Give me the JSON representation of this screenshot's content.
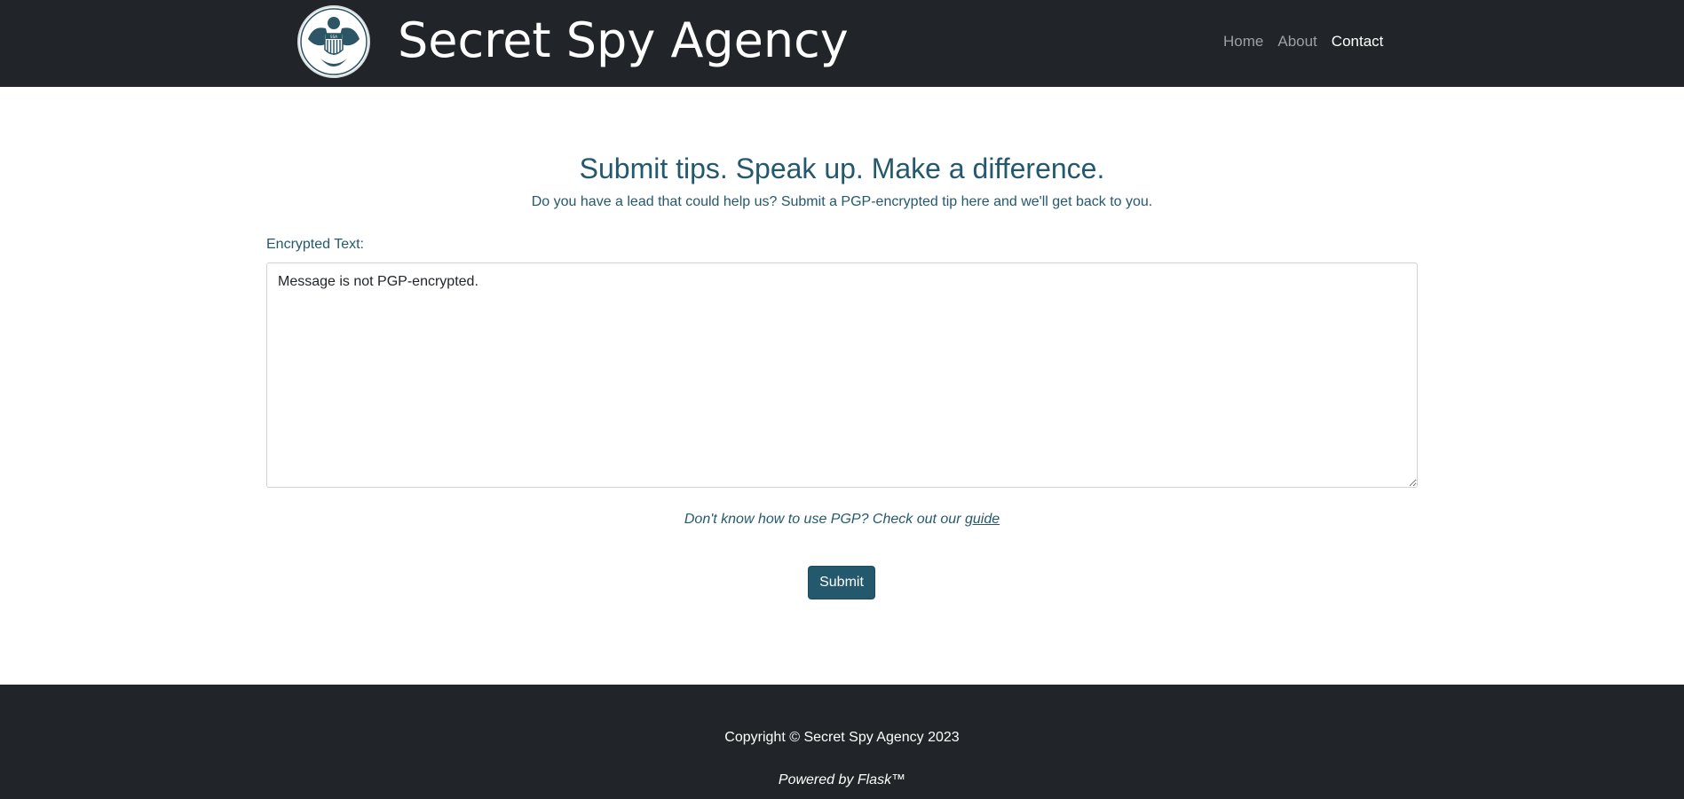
{
  "header": {
    "brand": "Secret Spy Agency",
    "logo_text": "SSA",
    "nav": [
      {
        "label": "Home",
        "active": false
      },
      {
        "label": "About",
        "active": false
      },
      {
        "label": "Contact",
        "active": true
      }
    ]
  },
  "main": {
    "heading": "Submit tips. Speak up. Make a difference.",
    "subheading": "Do you have a lead that could help us? Submit a PGP-encrypted tip here and we'll get back to you.",
    "field_label": "Encrypted Text:",
    "textarea_value": "Message is not PGP-encrypted.",
    "guide_prefix": "Don't know how to use PGP? Check out our ",
    "guide_link": "guide",
    "submit_label": "Submit"
  },
  "footer": {
    "copyright": "Copyright © Secret Spy Agency 2023",
    "powered": "Powered by Flask™"
  },
  "colors": {
    "header_bg": "#212529",
    "accent": "#24596d",
    "nav_inactive": "#9aa0a6",
    "nav_active": "#ffffff"
  },
  "icons": {
    "logo": "eagle-seal-icon"
  }
}
